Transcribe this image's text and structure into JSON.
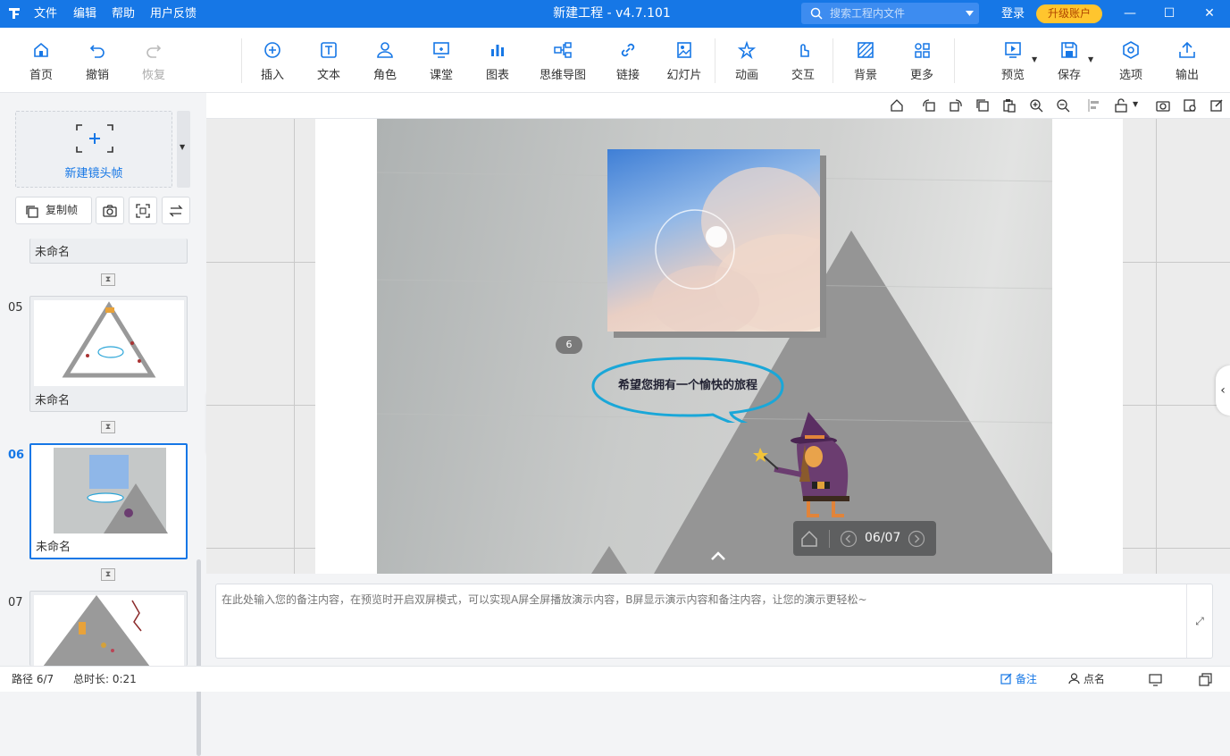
{
  "app": {
    "title": "新建工程 - v4.7.101"
  },
  "menu": [
    "文件",
    "编辑",
    "帮助",
    "用户反馈"
  ],
  "search": {
    "placeholder": "搜索工程内文件"
  },
  "account": {
    "login": "登录",
    "upgrade": "升级账户"
  },
  "toolbar": {
    "home": "首页",
    "undo": "撤销",
    "redo": "恢复",
    "insert": "插入",
    "text": "文本",
    "role": "角色",
    "classroom": "课堂",
    "chart": "图表",
    "mindmap": "思维导图",
    "link": "链接",
    "slides": "幻灯片",
    "animation": "动画",
    "interaction": "交互",
    "background": "背景",
    "more": "更多",
    "preview": "预览",
    "save": "保存",
    "options": "选项",
    "export": "输出"
  },
  "colors": {
    "primary": "#1677e6",
    "upgrade": "#ffc52e",
    "bubble": "#1aa7d8"
  },
  "left_panel": {
    "new_frame": "新建镜头帧",
    "copy_frame": "复制帧",
    "frames": [
      {
        "num": "",
        "name": "未命名"
      },
      {
        "num": "05",
        "name": "未命名"
      },
      {
        "num": "06",
        "name": "未命名",
        "active": true
      },
      {
        "num": "07",
        "name": ""
      }
    ]
  },
  "slide": {
    "badge": "6",
    "bubble_text": "希望您拥有一个愉快的旅程",
    "nav_counter": "06/07"
  },
  "notes": {
    "placeholder": "在此处输入您的备注内容，在预览时开启双屏模式，可以实现A屏全屏播放演示内容，B屏显示演示内容和备注内容，让您的演示更轻松~"
  },
  "status": {
    "path": "路径 6/7",
    "duration": "总时长: 0:21",
    "notes_btn": "备注",
    "rollcall_btn": "点名"
  }
}
